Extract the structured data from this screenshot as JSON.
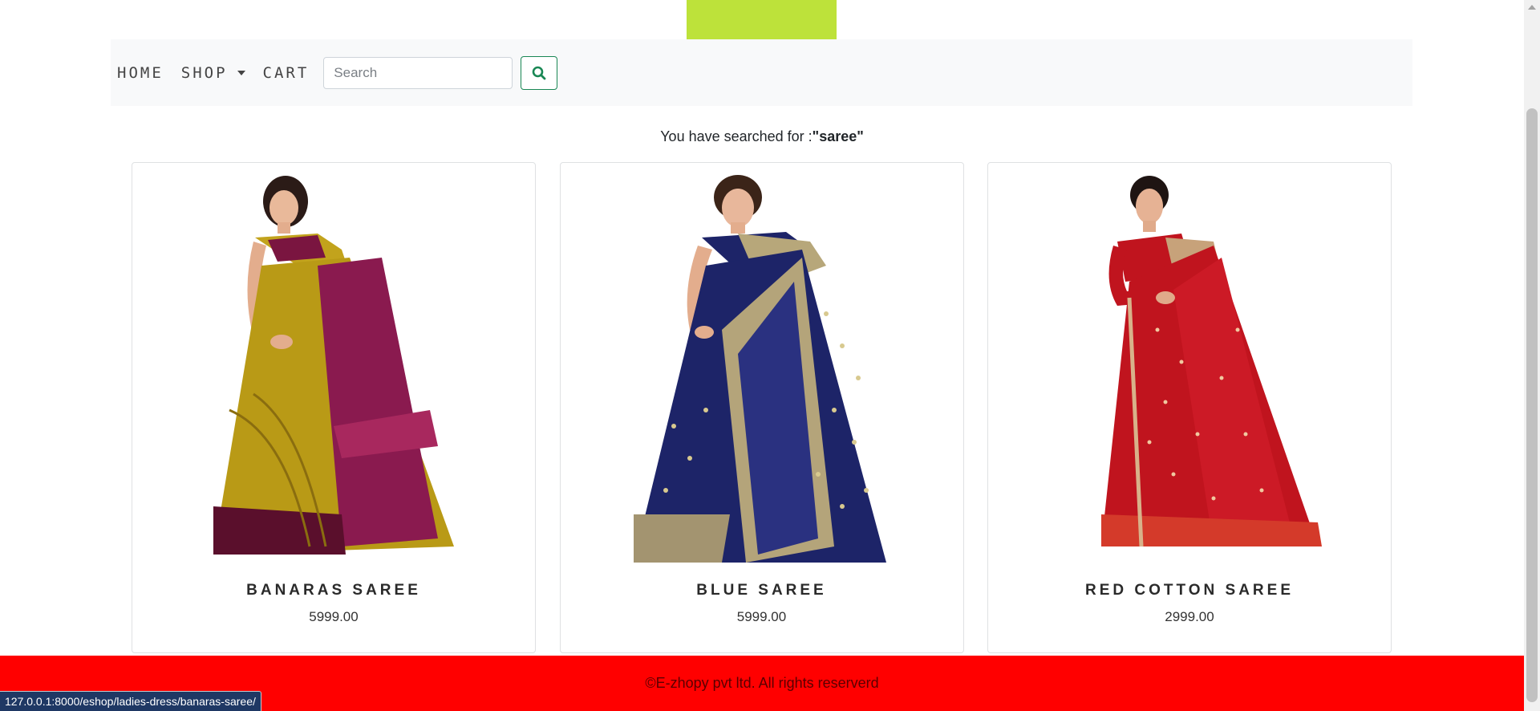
{
  "nav": {
    "home_label": "HOME",
    "shop_label": "SHOP",
    "cart_label": "CART"
  },
  "search": {
    "placeholder": "Search",
    "value": ""
  },
  "result": {
    "prefix": "You have searched for :",
    "query": "\"saree\""
  },
  "products": [
    {
      "name": "BANARAS SAREE",
      "price": "5999.00"
    },
    {
      "name": "BLUE SAREE",
      "price": "5999.00"
    },
    {
      "name": "RED COTTON SAREE",
      "price": "2999.00"
    }
  ],
  "footer": {
    "text": "©E-zhopy pvt ltd. All rights reserverd"
  },
  "status_bar": {
    "url": "127.0.0.1:8000/eshop/ladies-dress/banaras-saree/"
  },
  "colors": {
    "logo_block": "#bde23a",
    "footer_bg": "#ff0000",
    "search_button": "#198754"
  },
  "icons": {
    "search_button": "search-icon",
    "shop_dropdown": "caret-down-icon"
  }
}
